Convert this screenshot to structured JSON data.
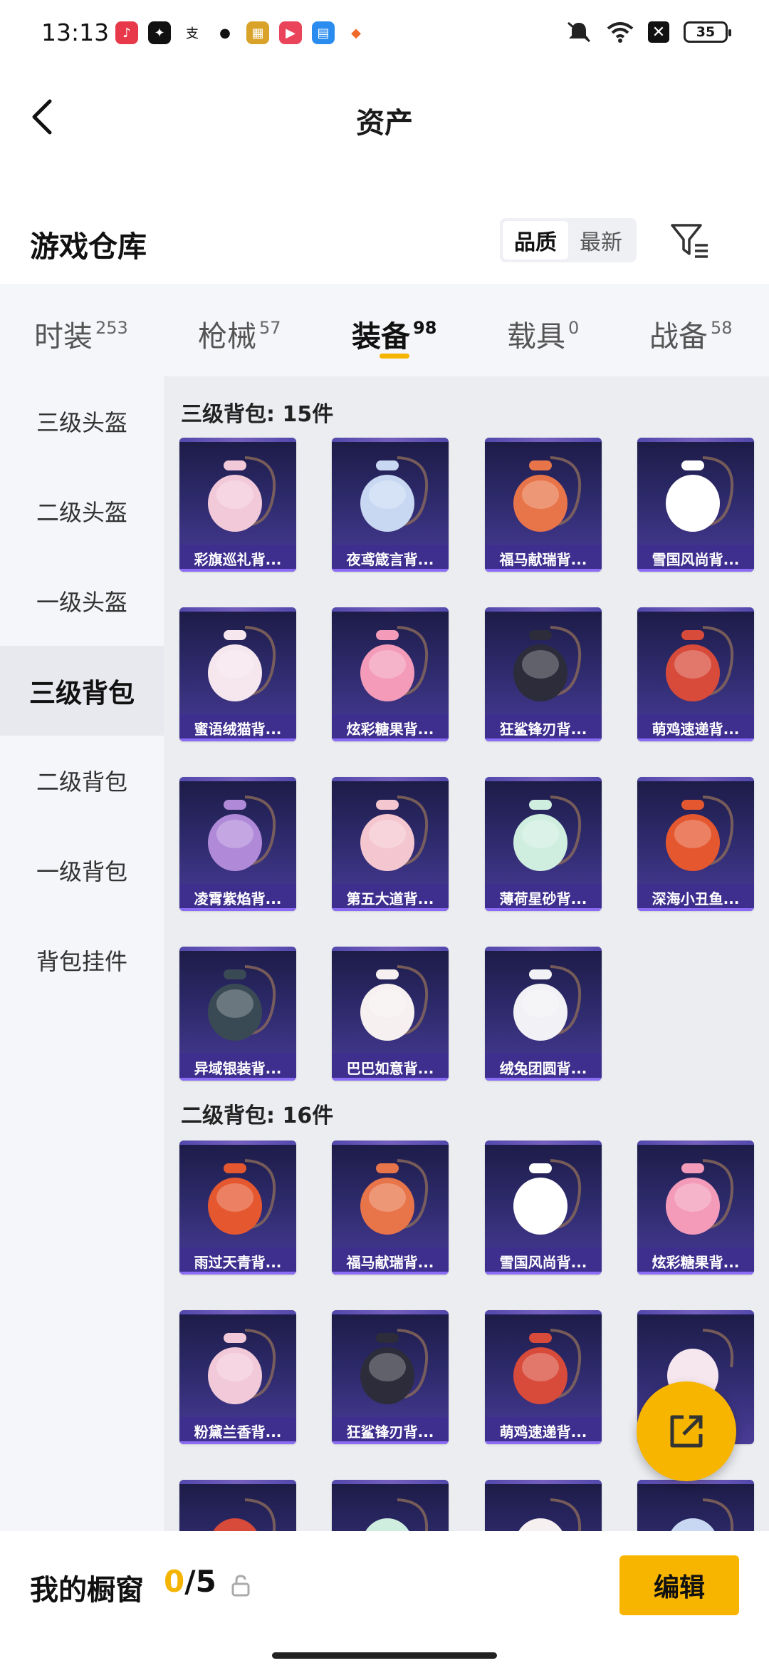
{
  "status_bar": {
    "time": "13:13",
    "battery": "35"
  },
  "header": {
    "title": "资产"
  },
  "warehouse": {
    "title": "游戏仓库",
    "sort_options": [
      "品质",
      "最新"
    ],
    "active_sort": "品质"
  },
  "tabs": [
    {
      "label": "时装",
      "count": "253"
    },
    {
      "label": "枪械",
      "count": "57"
    },
    {
      "label": "装备",
      "count": "98"
    },
    {
      "label": "载具",
      "count": "0"
    },
    {
      "label": "战备",
      "count": "58"
    }
  ],
  "active_tab": "装备",
  "sidebar": {
    "items": [
      "三级头盔",
      "二级头盔",
      "一级头盔",
      "三级背包",
      "二级背包",
      "一级背包",
      "背包挂件"
    ],
    "active": "三级背包"
  },
  "sections": [
    {
      "title": "三级背包: 15件",
      "items": [
        "彩旗巡礼背...",
        "夜鸢箴言背...",
        "福马献瑞背...",
        "雪国风尚背...",
        "蜜语绒猫背...",
        "炫彩糖果背...",
        "狂鲨锋刃背...",
        "萌鸡速递背...",
        "凌霄紫焰背...",
        "第五大道背...",
        "薄荷星砂背...",
        "深海小丑鱼...",
        "异域银装背...",
        "巴巴如意背...",
        "绒兔团圆背..."
      ]
    },
    {
      "title": "二级背包: 16件",
      "items": [
        "雨过天青背...",
        "福马献瑞背...",
        "雪国风尚背...",
        "炫彩糖果背...",
        "粉黛兰香背...",
        "狂鲨锋刃背...",
        "萌鸡速递背..."
      ]
    }
  ],
  "bottom_bar": {
    "title": "我的橱窗",
    "current": "0",
    "total": "/5",
    "edit_label": "编辑"
  },
  "colors": {
    "accent": "#f7b500",
    "card_dark": "#1c1b45",
    "card_label": "#3e2f8f"
  }
}
